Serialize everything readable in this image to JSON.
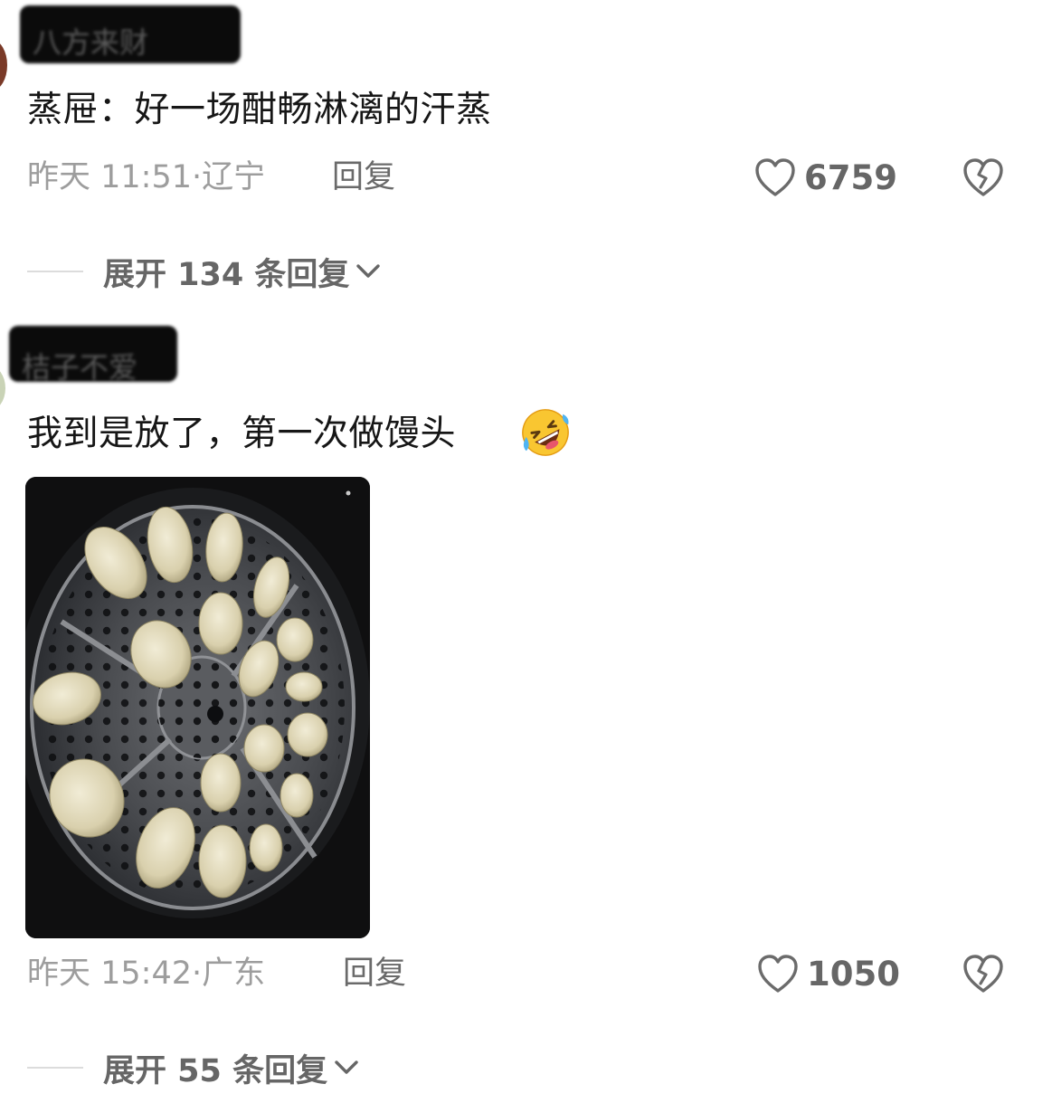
{
  "comments": [
    {
      "username": "八方来财",
      "text": "蒸屉：好一场酣畅淋漓的汗蒸",
      "time": "昨天 11:51",
      "location": "辽宁",
      "reply_label": "回复",
      "likes": "6759",
      "expand_label": "展开 134 条回复"
    },
    {
      "username": "桔子不爱",
      "text": "我到是放了，第一次做馒头",
      "emoji": "rolling-on-floor-laughing",
      "image_alt": "steamer-with-dough-buns",
      "time": "昨天 15:42",
      "location": "广东",
      "reply_label": "回复",
      "likes": "1050",
      "expand_label": "展开 55 条回复"
    }
  ],
  "colors": {
    "text": "#161616",
    "meta": "#9d9d9d",
    "action": "#666666",
    "icon": "#6b6b6b"
  },
  "icons": [
    "heart-outline-icon",
    "broken-heart-icon",
    "chevron-down-icon"
  ]
}
